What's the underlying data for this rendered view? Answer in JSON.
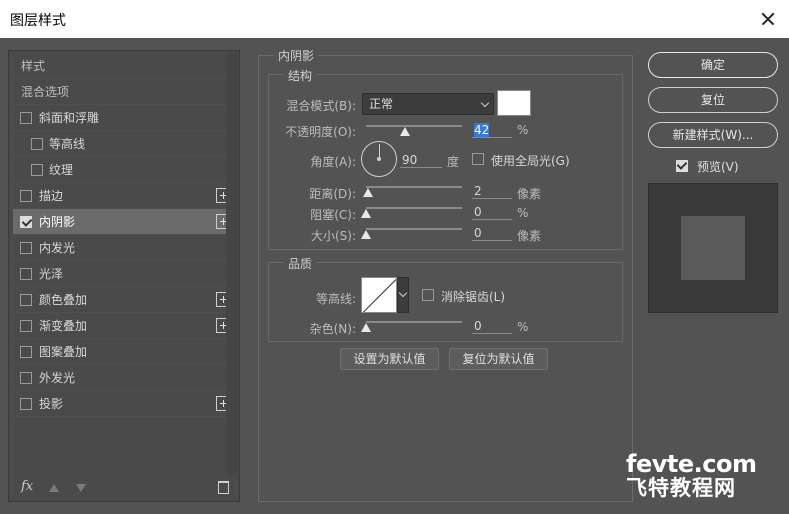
{
  "window": {
    "title": "图层样式"
  },
  "sidebar": {
    "items": [
      {
        "label": "样式"
      },
      {
        "label": "混合选项"
      },
      {
        "label": "斜面和浮雕"
      },
      {
        "label": "等高线"
      },
      {
        "label": "纹理"
      },
      {
        "label": "描边"
      },
      {
        "label": "内阴影"
      },
      {
        "label": "内发光"
      },
      {
        "label": "光泽"
      },
      {
        "label": "颜色叠加"
      },
      {
        "label": "渐变叠加"
      },
      {
        "label": "图案叠加"
      },
      {
        "label": "外发光"
      },
      {
        "label": "投影"
      }
    ],
    "footer": {
      "fx": "fx"
    }
  },
  "inner_shadow": {
    "title": "内阴影",
    "structure": {
      "title": "结构",
      "blend_mode_label": "混合模式(B):",
      "blend_mode_value": "正常",
      "color": "#ffffff",
      "opacity_label": "不透明度(O):",
      "opacity_value": "42",
      "opacity_unit": "%",
      "angle_label": "角度(A):",
      "angle_value": "90",
      "angle_unit": "度",
      "global_light_label": "使用全局光(G)",
      "distance_label": "距离(D):",
      "distance_value": "2",
      "distance_unit": "像素",
      "choke_label": "阻塞(C):",
      "choke_value": "0",
      "choke_unit": "%",
      "size_label": "大小(S):",
      "size_value": "0",
      "size_unit": "像素"
    },
    "quality": {
      "title": "品质",
      "contour_label": "等高线:",
      "antialias_label": "消除锯齿(L)",
      "noise_label": "杂色(N):",
      "noise_value": "0",
      "noise_unit": "%"
    },
    "set_default": "设置为默认值",
    "reset_default": "复位为默认值"
  },
  "actions": {
    "ok": "确定",
    "reset": "复位",
    "new_style": "新建样式(W)...",
    "preview_label": "预览(V)"
  },
  "watermark": {
    "line1": "fevte.com",
    "line2": "飞特教程网"
  }
}
